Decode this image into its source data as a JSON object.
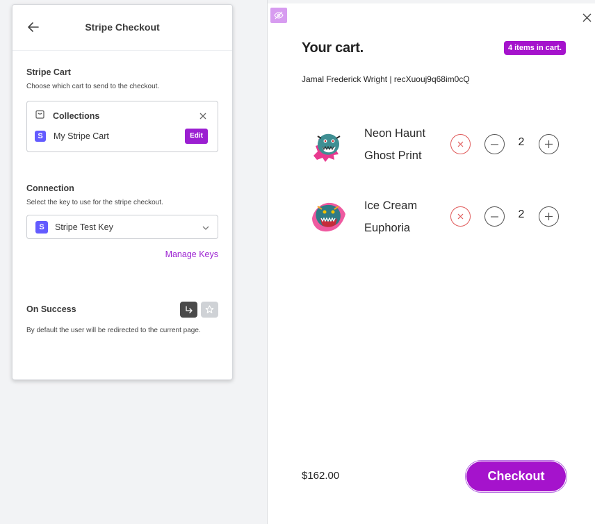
{
  "panel": {
    "title": "Stripe Checkout",
    "stripe_cart": {
      "title": "Stripe Cart",
      "description": "Choose which cart to send to the checkout.",
      "source_label": "Collections",
      "cart_name": "My Stripe Cart",
      "edit_label": "Edit",
      "badge_letter": "S"
    },
    "connection": {
      "title": "Connection",
      "description": "Select the key to use for the stripe checkout.",
      "selected_key": "Stripe Test Key",
      "badge_letter": "S",
      "manage_link": "Manage Keys"
    },
    "on_success": {
      "title": "On Success",
      "description": "By default the user will be redirected to the current page."
    }
  },
  "cart": {
    "title": "Your cart.",
    "count_badge": "4 items in cart.",
    "customer": "Jamal Frederick Wright | recXuouj9q68im0cQ",
    "items": [
      {
        "name": "Neon Haunt Ghost Print",
        "qty": "2"
      },
      {
        "name": "Ice Cream Euphoria",
        "qty": "2"
      }
    ],
    "total": "$162.00",
    "checkout_label": "Checkout"
  },
  "colors": {
    "accent": "#a513cc",
    "stripe_badge": "#635bff",
    "remove_red": "#e05a5a"
  }
}
